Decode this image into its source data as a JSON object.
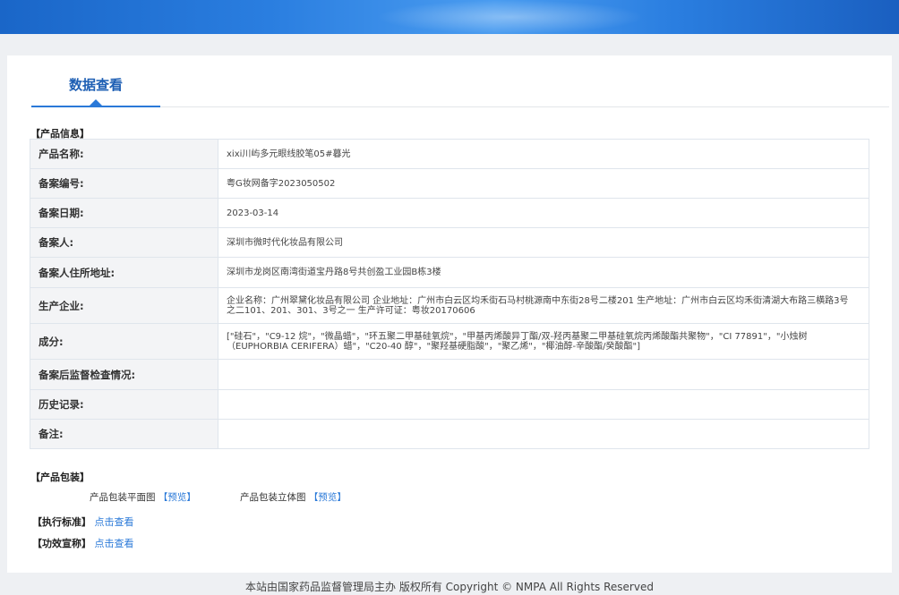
{
  "page": {
    "tab_label": "数据查看",
    "footer": "本站由国家药品监督管理局主办 版权所有 Copyright © NMPA All Rights Reserved"
  },
  "product_info": {
    "section_title": "【产品信息】",
    "rows": [
      {
        "label": "产品名称:",
        "value": "xixi川屿多元眼线胶笔05#暮光"
      },
      {
        "label": "备案编号:",
        "value": "粤G妆网备字2023050502"
      },
      {
        "label": "备案日期:",
        "value": "2023-03-14"
      },
      {
        "label": "备案人:",
        "value": "深圳市微时代化妆品有限公司"
      },
      {
        "label": "备案人住所地址:",
        "value": "深圳市龙岗区南湾街道宝丹路8号共创盈工业园B栋3楼"
      },
      {
        "label": "生产企业:",
        "value": "企业名称：广州翠黛化妆品有限公司 企业地址：广州市白云区均禾街石马村桃源南中东街28号二楼201 生产地址：广州市白云区均禾街清湖大布路三横路3号之二101、201、301、3号之一 生产许可证：粤妆20170606"
      },
      {
        "label": "成分:",
        "value": "[\"硅石\"，\"C9-12 烷\"，\"微晶蜡\"，\"环五聚二甲基硅氧烷\"，\"甲基丙烯酸异丁酯/双-羟丙基聚二甲基硅氧烷丙烯酸酯共聚物\"，\"CI 77891\"，\"小烛树（EUPHORBIA CERIFERA）蜡\"，\"C20-40 醇\"，\"聚羟基硬脂酸\"，\"聚乙烯\"，\"椰油醇-辛酸酯/癸酸酯\"]"
      },
      {
        "label": "备案后监督检查情况:",
        "value": ""
      },
      {
        "label": "历史记录:",
        "value": ""
      },
      {
        "label": "备注:",
        "value": ""
      }
    ]
  },
  "packaging": {
    "section_title": "【产品包装】",
    "flat_label": "产品包装平面图",
    "flat_link": "【预览】",
    "solid_label": "产品包装立体图",
    "solid_link": "【预览】"
  },
  "standard": {
    "label": "【执行标准】",
    "link": "点击查看"
  },
  "efficacy": {
    "label": "【功效宣称】",
    "link": "点击查看"
  }
}
